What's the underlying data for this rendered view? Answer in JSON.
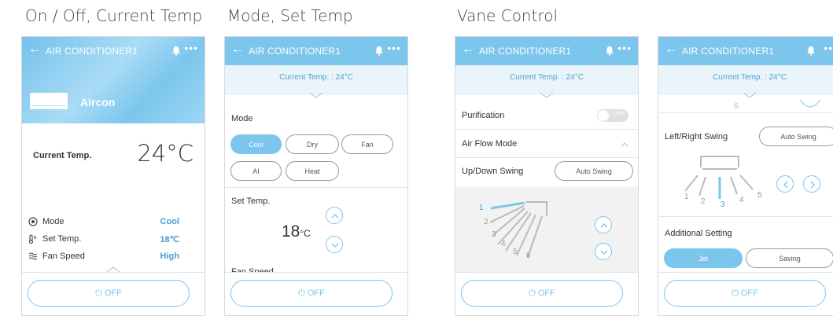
{
  "sections": {
    "s1": "On / Off, Current Temp",
    "s2": "Mode, Set Temp",
    "s3": "Vane Control"
  },
  "app": {
    "title": "AIR CONDITIONER1",
    "back_icon": "back-arrow-icon",
    "bell_icon": "bell-icon",
    "more_icon": "more-icon"
  },
  "phone1": {
    "device_name": "Aircon",
    "current_temp_label": "Current Temp.",
    "current_temp_value": "24°C",
    "rows": [
      {
        "label": "Mode",
        "value": "Cool",
        "icon": "mode-icon"
      },
      {
        "label": "Set Temp.",
        "value": "18℃",
        "icon": "thermometer-icon"
      },
      {
        "label": "Fan Speed",
        "value": "High",
        "icon": "fan-icon"
      }
    ],
    "off_label": "OFF"
  },
  "current_temp_bar": "Current Temp. : 24°C",
  "phone2": {
    "mode_label": "Mode",
    "modes": [
      "Cool",
      "Dry",
      "Fan",
      "AI",
      "Heat"
    ],
    "active_mode": "Cool",
    "set_temp_label": "Set Temp.",
    "set_temp_value": "18",
    "set_temp_unit": "°C",
    "fan_speed_partial": "Fan Speed",
    "off_label": "OFF"
  },
  "phone3": {
    "purification_label": "Purification",
    "purification_toggle": "OFF",
    "airflow_label": "Air Flow Mode",
    "updown_label": "Up/Down Swing",
    "auto_swing": "Auto Swing",
    "vane_positions": [
      "1",
      "2",
      "3",
      "4",
      "5",
      "6"
    ],
    "selected_vane": "1",
    "off_label": "OFF"
  },
  "phone4": {
    "top_partial_number": "6",
    "leftright_label": "Left/Right Swing",
    "auto_swing": "Auto Swing",
    "vane_positions": [
      "1",
      "2",
      "3",
      "4",
      "5"
    ],
    "selected_vane": "3",
    "additional_label": "Additional Setting",
    "options": [
      "Jet",
      "Saving"
    ],
    "active_option": "Jet",
    "off_label": "OFF"
  },
  "colors": {
    "accent": "#7cc5ec",
    "text_accent": "#4a9fd0",
    "border": "#d8d8d8"
  }
}
